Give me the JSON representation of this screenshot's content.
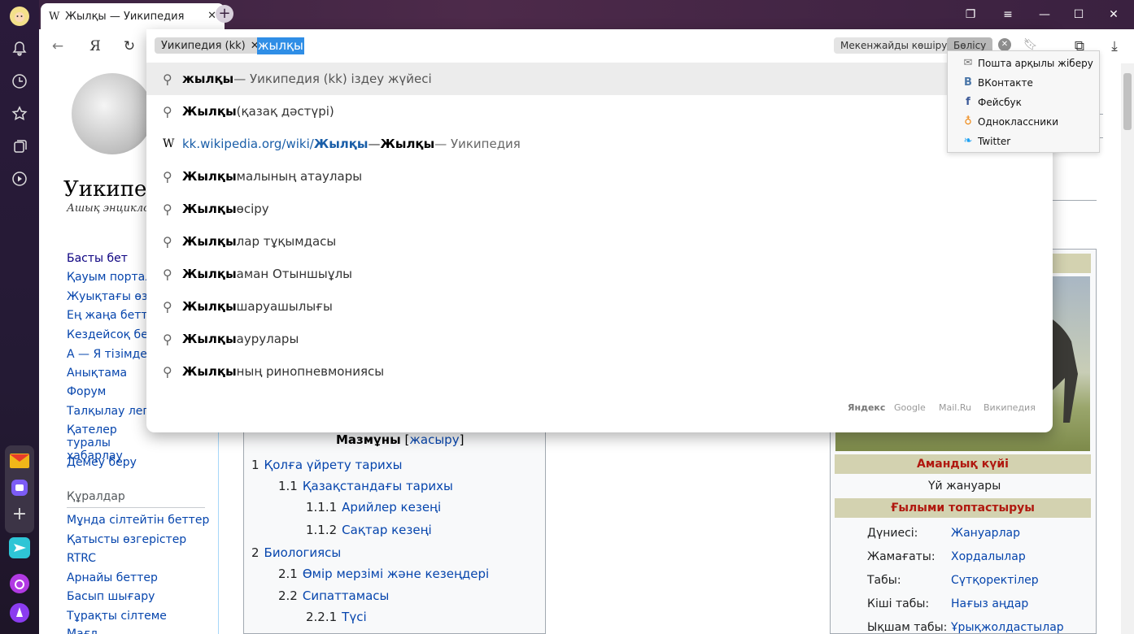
{
  "tab": {
    "favicon": "W",
    "title": "Жылқы — Уикипедия"
  },
  "address": {
    "site_chip": "Уикипедия (kk)",
    "query": "жылқы",
    "copy_address": "Мекенжайды көшіру",
    "share": "Бөлісу"
  },
  "suggestions": [
    {
      "bold": "жылқы",
      "rest": " — Уикипедия (kk) іздеу жүйесі",
      "type": "search"
    },
    {
      "bold": "Жылқы",
      "rest": " (қазақ дәстүрі)",
      "type": "search"
    },
    {
      "url": "kk.wikipedia.org/wiki/",
      "url_bold": "Жылқы",
      "mid": " — ",
      "title_bold": "Жылқы",
      "rest": " — Уикипедия",
      "type": "site"
    },
    {
      "bold": "Жылқы",
      "rest": " малының атаулары",
      "type": "search"
    },
    {
      "bold": "Жылқы",
      "rest": " өсіру",
      "type": "search"
    },
    {
      "bold": "Жылқы",
      "rest": "лар тұқымдасы",
      "type": "search"
    },
    {
      "bold": "Жылқы",
      "rest": "аман Отыншыұлы",
      "type": "search"
    },
    {
      "bold": "Жылқы",
      "rest": " шаруашылығы",
      "type": "search"
    },
    {
      "bold": "Жылқы",
      "rest": " аурулары",
      "type": "search"
    },
    {
      "bold": "Жылқы",
      "rest": "ның ринопневмониясы",
      "type": "search"
    }
  ],
  "engines": [
    "Яндекс",
    "Google",
    "Mail.Ru",
    "Википедия"
  ],
  "share_menu": [
    "Пошта арқылы жіберу",
    "ВКонтакте",
    "Фейсбук",
    "Одноклассники",
    "Twitter"
  ],
  "wiki": {
    "logo_text": "Уикипед",
    "logo_sub": "Ашық энцикло",
    "nav": [
      "Басты бет",
      "Қауым порталы",
      "Жуықтағы өзгер",
      "Ең жаңа беттер",
      "Кездейсоқ бет",
      "А — Я тізімде",
      "Анықтама",
      "Форум",
      "Талқылау легі",
      "Қателер туралы хабарлау",
      "Демеу беру"
    ],
    "tools_heading": "Құралдар",
    "tools": [
      "Мұнда сілтейтін беттер",
      "Қатысты өзгерістер",
      "RTRC",
      "Арнайы беттер",
      "Басып шығару",
      "Тұрақты сілтеме",
      "Мағл"
    ],
    "toc_title": "Мазмұны",
    "toc_hide": "жасыру",
    "toc": [
      {
        "n": "1",
        "t": "Қолға үйрету тарихы",
        "lvl": 0
      },
      {
        "n": "1.1",
        "t": "Қазақстандағы тарихы",
        "lvl": 1
      },
      {
        "n": "1.1.1",
        "t": "Арийлер кезеңі",
        "lvl": 2
      },
      {
        "n": "1.1.2",
        "t": "Сақтар кезеңі",
        "lvl": 2
      },
      {
        "n": "2",
        "t": "Биологиясы",
        "lvl": 0
      },
      {
        "n": "2.1",
        "t": "Өмір мерзімі және кезеңдері",
        "lvl": 1
      },
      {
        "n": "2.2",
        "t": "Сипаттамасы",
        "lvl": 1
      },
      {
        "n": "2.2.1",
        "t": "Түсі",
        "lvl": 2
      }
    ],
    "infobox": {
      "status_head": "Амандық күйі",
      "status": "Үй жануары",
      "taxo_head": "Ғылыми топтастыруы",
      "rows": [
        {
          "k": "Дүниесі:",
          "v": "Жануарлар"
        },
        {
          "k": "Жамағаты:",
          "v": "Хордалылар"
        },
        {
          "k": "Табы:",
          "v": "Сүтқоректілер"
        },
        {
          "k": "Кіші табы:",
          "v": "Нағыз аңдар"
        },
        {
          "k": "Ықшам табы:",
          "v": "Ұрықжолдастылар"
        }
      ]
    }
  }
}
